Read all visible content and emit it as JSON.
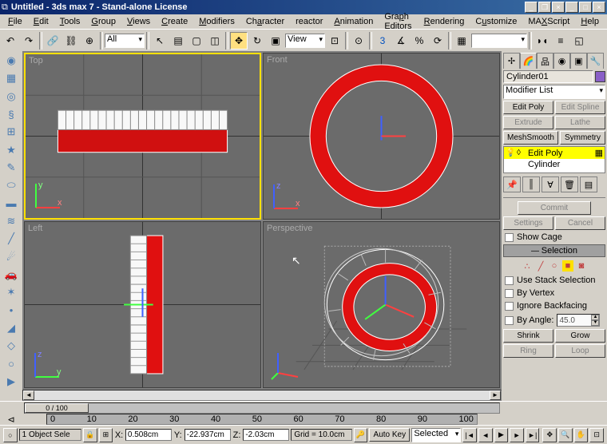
{
  "title": "Untitled - 3ds max 7 - Stand-alone License",
  "menus": [
    "File",
    "Edit",
    "Tools",
    "Group",
    "Views",
    "Create",
    "Modifiers",
    "Character",
    "reactor",
    "Animation",
    "Graph Editors",
    "Rendering",
    "Customize",
    "MAXScript",
    "Help"
  ],
  "toolbar": {
    "filter": "All",
    "view": "View"
  },
  "viewports": {
    "top": "Top",
    "front": "Front",
    "left": "Left",
    "persp": "Perspective"
  },
  "modify": {
    "object_name": "Cylinder01",
    "modifier_list": "Modifier List",
    "btn_editpoly": "Edit Poly",
    "btn_editspline": "Edit Spline",
    "btn_extrude": "Extrude",
    "btn_lathe": "Lathe",
    "btn_meshsmooth": "MeshSmooth",
    "btn_symmetry": "Symmetry",
    "stack": [
      {
        "name": "Edit Poly",
        "icon": "◊",
        "selected": true,
        "bulb": true
      },
      {
        "name": "Cylinder",
        "icon": "",
        "selected": false
      }
    ],
    "commit": "Commit",
    "settings": "Settings",
    "cancel": "Cancel",
    "show_cage": "Show Cage",
    "selection_title": "Selection",
    "use_stack": "Use Stack Selection",
    "by_vertex": "By Vertex",
    "ignore_backfacing": "Ignore Backfacing",
    "by_angle": "By Angle:",
    "angle_value": "45.0",
    "shrink": "Shrink",
    "grow": "Grow",
    "ring": "Ring",
    "loop": "Loop"
  },
  "timeline": {
    "slider": "0 / 100",
    "ticks": [
      "0",
      "10",
      "20",
      "30",
      "40",
      "50",
      "60",
      "70",
      "80",
      "90",
      "100"
    ]
  },
  "status": {
    "sel": "1 Object Sele",
    "x": "0.508cm",
    "y": "-22.937cm",
    "z": "-2.03cm",
    "grid": "Grid = 10.0cm",
    "autokey": "Auto Key",
    "keymode": "Selected"
  }
}
